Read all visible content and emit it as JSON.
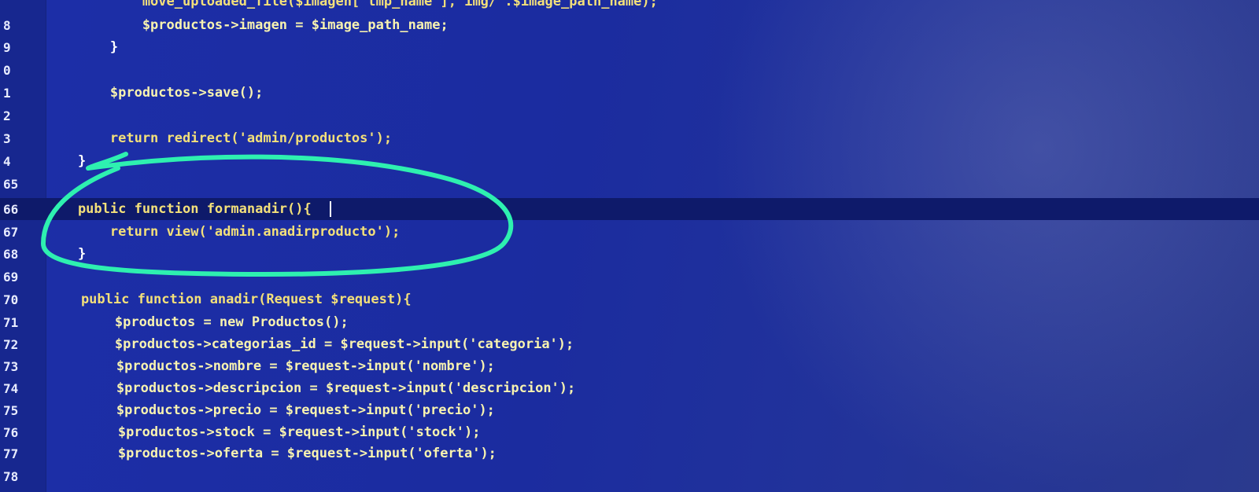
{
  "colors": {
    "background": "#1b2c9f",
    "annotation": "#2ef0b0"
  },
  "lines": [
    {
      "num": "",
      "code": "            move_uploaded_file($imagen['tmp_name'],'img/'.$image_path_name);"
    },
    {
      "num": "8",
      "code": "            $productos->imagen = $image_path_name;"
    },
    {
      "num": "9",
      "code": "        }"
    },
    {
      "num": "0",
      "code": ""
    },
    {
      "num": "1",
      "code": "        $productos->save();"
    },
    {
      "num": "2",
      "code": ""
    },
    {
      "num": "3",
      "code": "        return redirect('admin/productos');"
    },
    {
      "num": "4",
      "code": "    }"
    },
    {
      "num": "65",
      "code": ""
    },
    {
      "num": "66",
      "code": "    public function formanadir(){"
    },
    {
      "num": "67",
      "code": "        return view('admin.anadirproducto');"
    },
    {
      "num": "68",
      "code": "    }"
    },
    {
      "num": "69",
      "code": ""
    },
    {
      "num": "70",
      "code": "    public function anadir(Request $request){"
    },
    {
      "num": "71",
      "code": "        $productos = new Productos();"
    },
    {
      "num": "72",
      "code": "        $productos->categorias_id = $request->input('categoria');"
    },
    {
      "num": "73",
      "code": "        $productos->nombre = $request->input('nombre');"
    },
    {
      "num": "74",
      "code": "        $productos->descripcion = $request->input('descripcion');"
    },
    {
      "num": "75",
      "code": "        $productos->precio = $request->input('precio');"
    },
    {
      "num": "76",
      "code": "        $productos->stock = $request->input('stock');"
    },
    {
      "num": "77",
      "code": "        $productos->oferta = $request->input('oferta');"
    },
    {
      "num": "78",
      "code": ""
    }
  ]
}
